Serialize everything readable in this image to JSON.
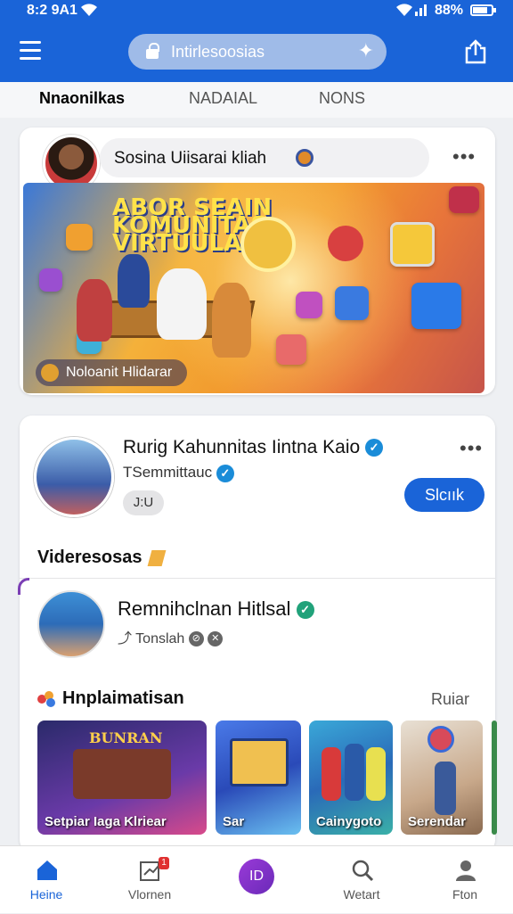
{
  "status_bar": {
    "time": "8:2 9A1",
    "battery": "88%"
  },
  "header": {
    "search_text": "Intirlesoosias"
  },
  "tabs": [
    {
      "label": "Nnaonilkas",
      "active": true
    },
    {
      "label": "NADAIAL",
      "active": false
    },
    {
      "label": "NONS",
      "active": false
    }
  ],
  "post": {
    "composer_text": "Sosina Uiisarai kliah",
    "banner_headline_1": "ABOR SEAIN",
    "banner_headline_2": "KOMUNITAS",
    "banner_headline_3": "VIRTUULA",
    "banner_caption": "Noloanit Hlidarar"
  },
  "group": {
    "title": "Rurig Kahunnitas Iintna Kaio",
    "subtitle": "TSemmittauc",
    "chip": "J:U",
    "follow_label": "Slcıık"
  },
  "videos": {
    "section_title": "Videresosas",
    "person_name": "Remnihclnan Hitlsal",
    "person_sub": "Tonslah"
  },
  "recommend": {
    "title": "Hnplaimatisan",
    "more": "Ruiar",
    "thumbs": [
      {
        "label": "Setpiar Iaga Klriear",
        "banner": "BUNRAN"
      },
      {
        "label": "Sar"
      },
      {
        "label": "Cainygoto"
      },
      {
        "label": "Serendar"
      }
    ]
  },
  "bottom_nav": [
    {
      "label": "Heine",
      "icon": "home-icon",
      "active": true
    },
    {
      "label": "Vlornen",
      "icon": "notification-icon",
      "badge": "1"
    },
    {
      "label": "",
      "icon": "create-icon",
      "center": "ID"
    },
    {
      "label": "Wetart",
      "icon": "search-icon"
    },
    {
      "label": "Fton",
      "icon": "profile-icon"
    }
  ],
  "colors": {
    "brand": "#1a64d8",
    "verified_blue": "#1a8cd8",
    "verified_green": "#21a27a",
    "accent_purple": "#7b3fb5"
  }
}
